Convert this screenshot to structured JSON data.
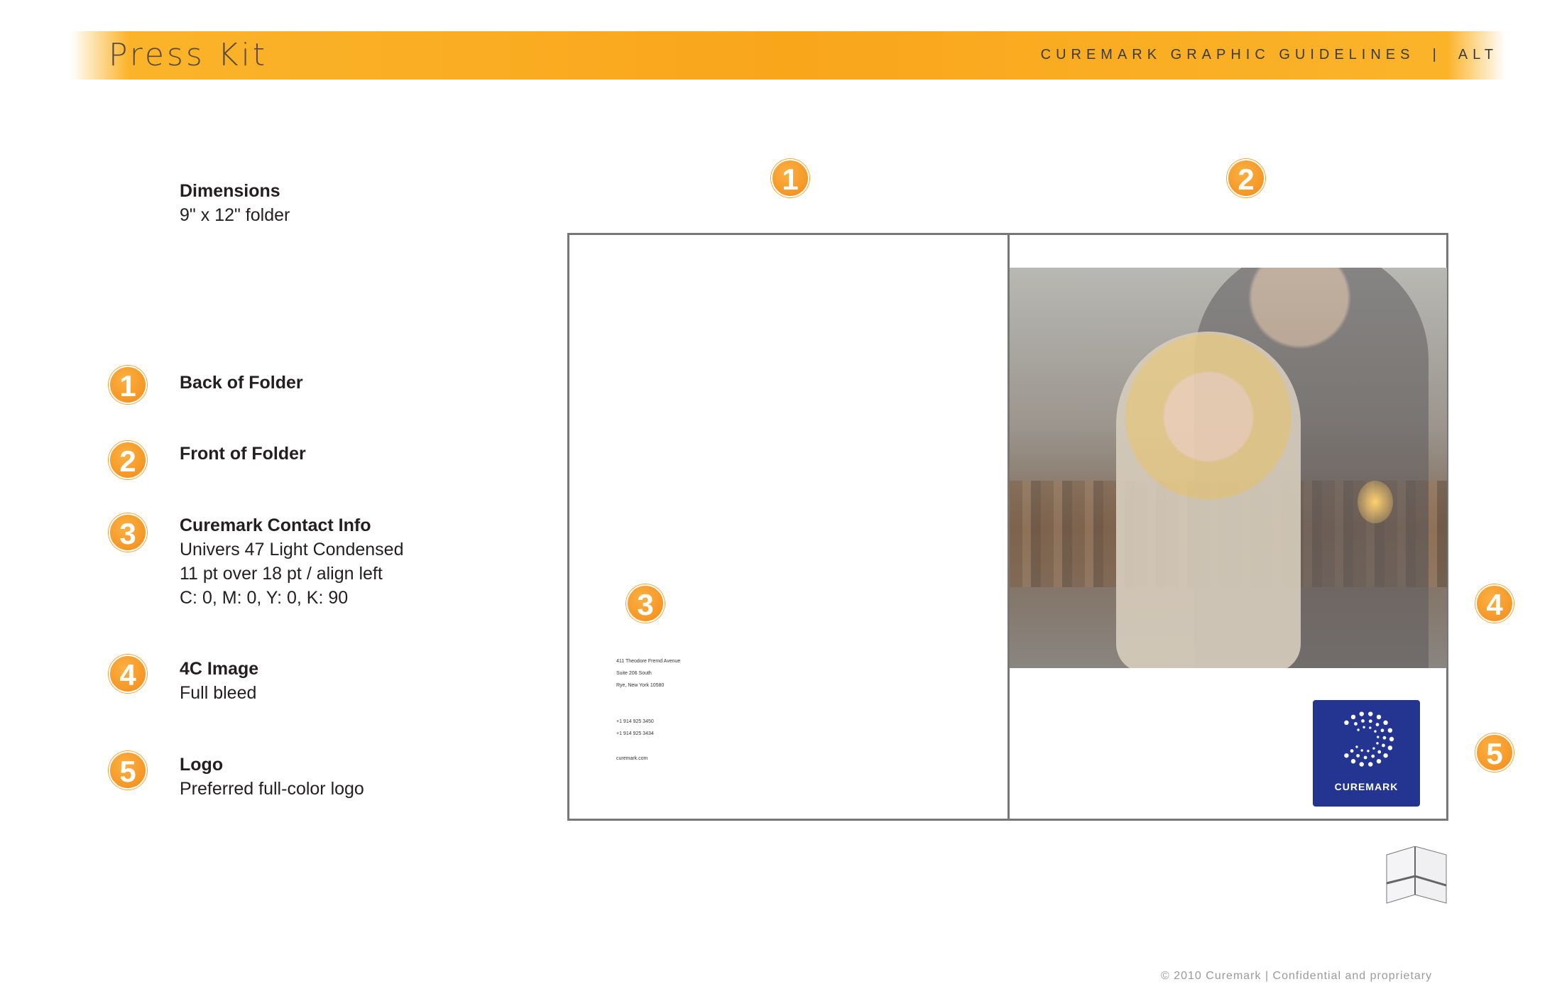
{
  "header": {
    "title": "Press Kit",
    "right_text": "CUREMARK GRAPHIC GUIDELINES  |  ALT",
    "brand_color": "#f9a61b"
  },
  "dimensions": {
    "heading": "Dimensions",
    "value": "9\" x 12\" folder"
  },
  "legend": [
    {
      "num": "1",
      "title": "Back of Folder",
      "lines": []
    },
    {
      "num": "2",
      "title": "Front of Folder",
      "lines": []
    },
    {
      "num": "3",
      "title": "Curemark Contact Info",
      "lines": [
        "Univers 47 Light Condensed",
        "11 pt over 18 pt / align left",
        "C: 0, M: 0, Y: 0, K: 90"
      ]
    },
    {
      "num": "4",
      "title": "4C Image",
      "lines": [
        "Full bleed"
      ]
    },
    {
      "num": "5",
      "title": "Logo",
      "lines": [
        "Preferred full-color logo"
      ]
    }
  ],
  "contact": {
    "address": [
      "411 Theodore Fremd Avenue",
      "Suite 206 South",
      "Rye, New York 10580"
    ],
    "phones": [
      "+1 914 925 3450",
      "+1 914 925 3434"
    ],
    "web": "curemark.com"
  },
  "logo": {
    "text": "CUREMARK",
    "color": "#233591"
  },
  "footer": "© 2010 Curemark | Confidential and proprietary"
}
